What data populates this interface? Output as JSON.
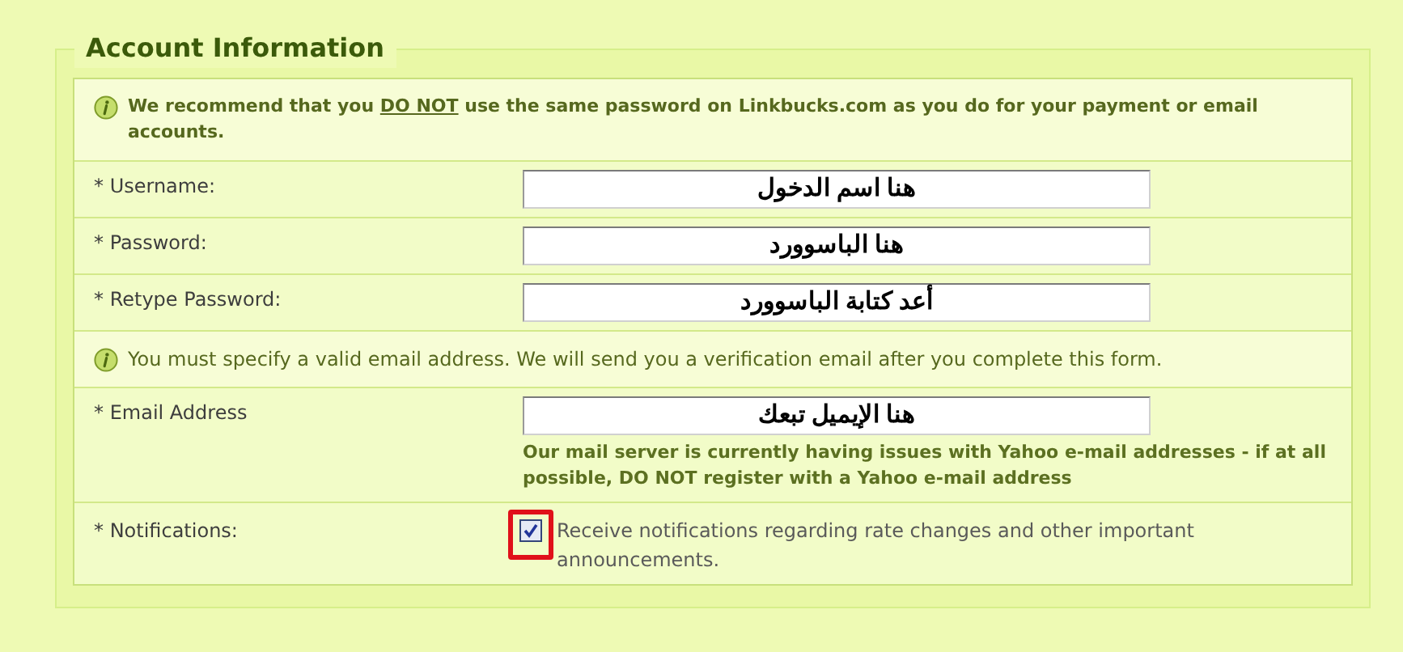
{
  "section": {
    "title": "Account Information"
  },
  "rows": [
    {
      "kind": "notice",
      "bold": true,
      "parts": [
        {
          "text": "We recommend that you ",
          "underlined": false
        },
        {
          "text": "DO NOT",
          "underlined": true
        },
        {
          "text": " use the same password on Linkbucks.com as you do for your payment or email accounts.",
          "underlined": false
        }
      ]
    },
    {
      "kind": "field",
      "label": "* Username:",
      "value": "هنا اسم الدخول"
    },
    {
      "kind": "field",
      "label": "* Password:",
      "value": "هنا الباسوورد"
    },
    {
      "kind": "field",
      "label": "* Retype Password:",
      "value": "أعد كتابة الباسوورد"
    },
    {
      "kind": "notice",
      "bold": false,
      "text": "You must specify a valid email address. We will send you a verification email after you complete this form."
    },
    {
      "kind": "field",
      "label": "* Email Address",
      "value": "هنا الإيميل تبعك",
      "warning": "Our mail server is currently having issues with Yahoo e-mail addresses - if at all possible, DO NOT register with a Yahoo e-mail address"
    },
    {
      "kind": "checkbox",
      "label": "* Notifications:",
      "text": "Receive notifications regarding rate changes and other important announcements.",
      "checked": true,
      "highlighted": true
    }
  ]
}
